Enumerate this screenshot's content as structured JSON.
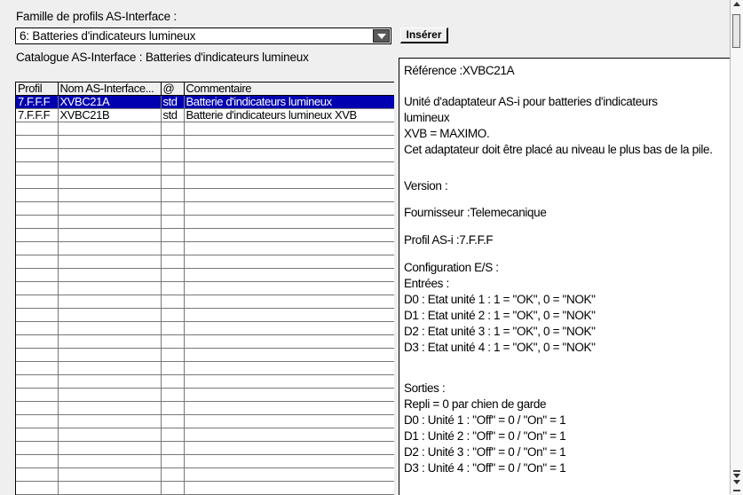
{
  "family": {
    "label": "Famille de profils AS-Interface :",
    "selected": "6: Batteries d'indicateurs lumineux",
    "insert_label": "Insérer"
  },
  "catalogue": {
    "label": "Catalogue AS-Interface : Batteries d'indicateurs lumineux",
    "columns": [
      "Profil",
      "Nom AS-Interface...",
      "@",
      "Commentaire"
    ],
    "rows": [
      [
        "7.F.F.F",
        "XVBC21A",
        "std",
        "Batterie d'indicateurs lumineux"
      ],
      [
        "7.F.F.F",
        "XVBC21B",
        "std",
        "Batterie d'indicateurs lumineux XVB"
      ]
    ],
    "selected_row": 0
  },
  "detail": {
    "reference": "Référence :XVBC21A",
    "description": [
      "Unité d'adaptateur AS-i pour batteries d'indicateurs",
      "lumineux",
      "XVB = MAXIMO.",
      "Cet adaptateur doit être placé au niveau le plus bas de la pile."
    ],
    "version": "Version :",
    "supplier": "Fournisseur :Telemecanique",
    "profile": "Profil AS-i :7.F.F.F",
    "io_config": [
      "Configuration E/S :",
      "Entrées :",
      "D0 : Etat unité 1 : 1 = \"OK\", 0 = \"NOK\"",
      "D1 : Etat unité 2 : 1 = \"OK\", 0 = \"NOK\"",
      "D2 : Etat unité 3 : 1 = \"OK\", 0 = \"NOK\"",
      "D3 : Etat unité 4 : 1 = \"OK\", 0 = \"NOK\""
    ],
    "outputs": [
      "Sorties :",
      "Repli = 0 par chien de garde",
      "D0 : Unité 1 : \"Off\" = 0 / \"On\" = 1",
      "D1 : Unité 2 : \"Off\" = 0 / \"On\" = 1",
      "D2 : Unité 3 : \"Off\" = 0 / \"On\" = 1",
      "D3 : Unité 4 : \"Off\" = 0 / \"On\" = 1"
    ]
  }
}
